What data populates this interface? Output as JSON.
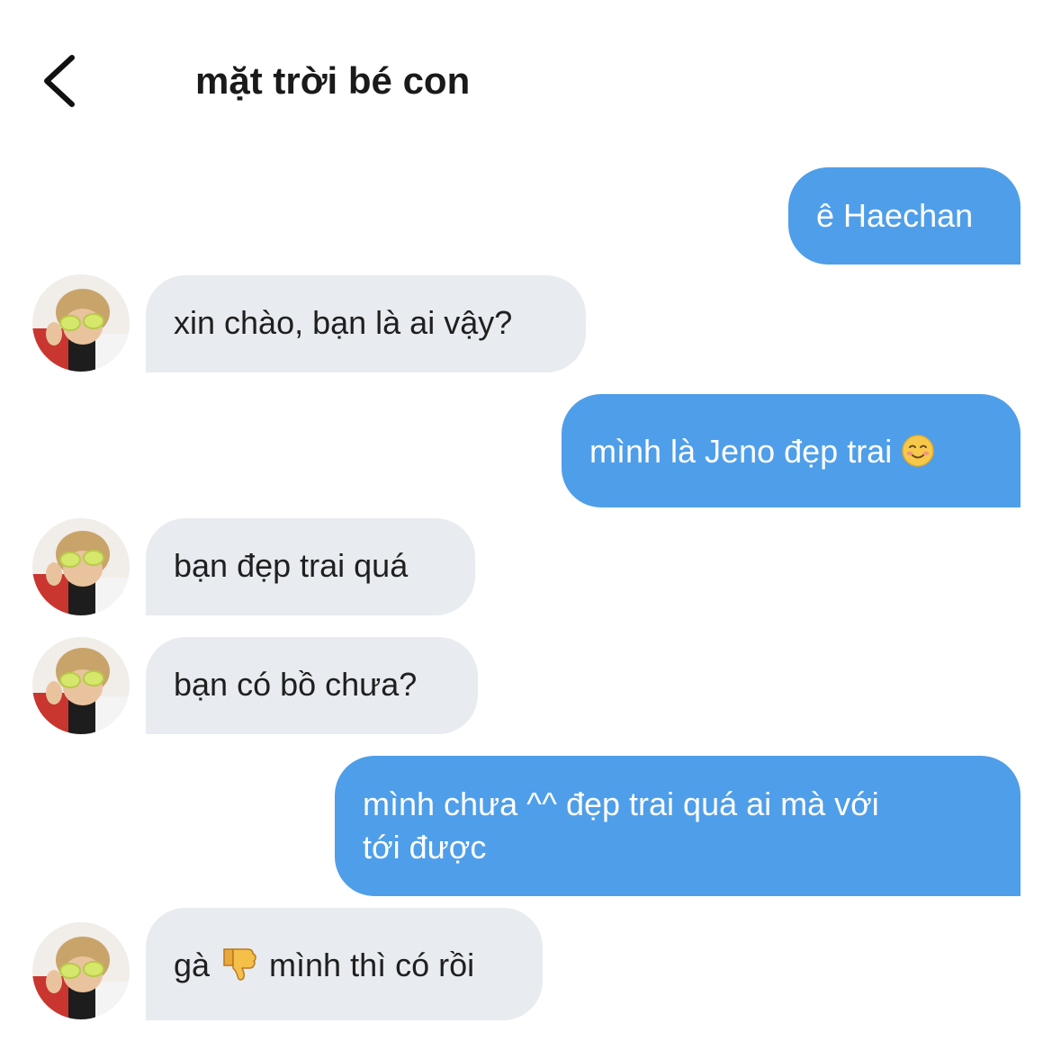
{
  "header": {
    "back_icon": "chevron-left-icon",
    "title": "mặt trời bé con"
  },
  "messages": [
    {
      "side": "outgoing",
      "text": "ê Haechan"
    },
    {
      "side": "incoming",
      "text": "xin chào, bạn là ai vậy?"
    },
    {
      "side": "outgoing",
      "text": "mình là Jeno đẹp trai",
      "emoji": "smiling-face-icon"
    },
    {
      "side": "incoming",
      "text": "bạn đẹp trai quá"
    },
    {
      "side": "incoming",
      "text": "bạn có bồ chưa?"
    },
    {
      "side": "outgoing",
      "lines": [
        "mình chưa ^^ đẹp trai quá ai mà với",
        "tới được"
      ]
    },
    {
      "side": "incoming",
      "prefix": "gà",
      "emoji": "thumbs-down-icon",
      "text": "mình thì có rồi"
    }
  ],
  "colors": {
    "outgoing_bubble": "#4f9ee9",
    "incoming_bubble": "#e8ebef",
    "background": "#ffffff"
  }
}
